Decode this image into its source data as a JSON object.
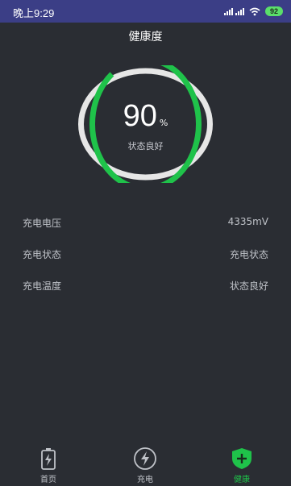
{
  "status_bar": {
    "time": "晚上9:29",
    "battery": "92",
    "bg": "#3b3e86"
  },
  "header": {
    "title": "健康度"
  },
  "gauge": {
    "value": 90,
    "value_text": "90",
    "unit": "%",
    "status": "状态良好",
    "color": "#1fc24a"
  },
  "details": [
    {
      "label": "充电电压",
      "value": "4335mV"
    },
    {
      "label": "充电状态",
      "value": "充电状态"
    },
    {
      "label": "充电温度",
      "value": "状态良好"
    }
  ],
  "nav": {
    "items": [
      {
        "label": "首页",
        "icon": "battery-icon"
      },
      {
        "label": "充电",
        "icon": "lightning-icon"
      },
      {
        "label": "健康",
        "icon": "shield-plus-icon",
        "active": true
      }
    ],
    "active_color": "#1fc24a"
  }
}
